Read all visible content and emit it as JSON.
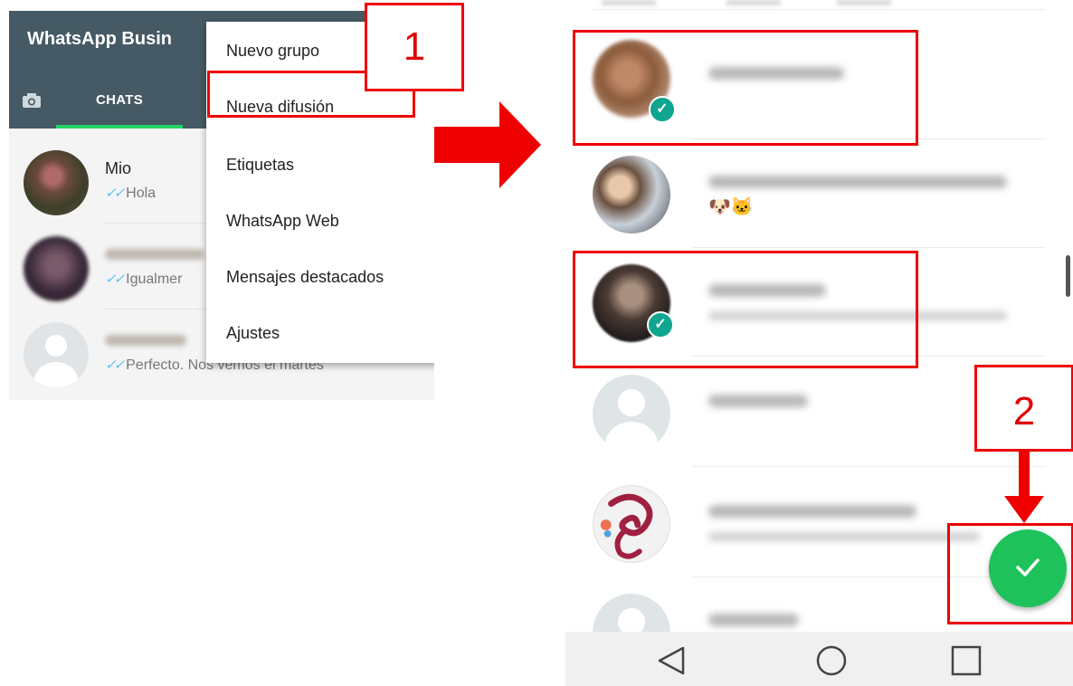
{
  "left_screen": {
    "app_title": "WhatsApp Busin",
    "tabs": [
      {
        "label": "CHATS",
        "selected": true
      }
    ],
    "chats": [
      {
        "name": "Mio",
        "last_message": "Hola",
        "name_blurred": false
      },
      {
        "name": "",
        "last_message": "Igualmer",
        "name_blurred": true
      },
      {
        "name": "",
        "last_message": "Perfecto. Nos vemos el martes",
        "name_blurred": true
      }
    ],
    "menu": {
      "items": [
        {
          "label": "Nuevo grupo"
        },
        {
          "label": "Nueva difusión",
          "highlighted": true
        },
        {
          "label": "Etiquetas"
        },
        {
          "label": "WhatsApp Web"
        },
        {
          "label": "Mensajes destacados"
        },
        {
          "label": "Ajustes"
        }
      ]
    }
  },
  "annotations": {
    "step_1": "1",
    "step_2": "2"
  },
  "right_screen": {
    "contacts": [
      {
        "selected": true,
        "avatar": "photo",
        "name_blurred": true
      },
      {
        "selected": false,
        "avatar": "photo",
        "name_blurred": true,
        "emoji": "🐶🐱"
      },
      {
        "selected": true,
        "avatar": "photo",
        "name_blurred": true
      },
      {
        "selected": false,
        "avatar": "placeholder",
        "name_blurred": true
      },
      {
        "selected": false,
        "avatar": "dragon",
        "name_blurred": true
      },
      {
        "selected": false,
        "avatar": "placeholder",
        "name_blurred": true
      }
    ],
    "fab_icon": "checkmark-icon",
    "nav_icons": [
      "back-triangle-icon",
      "home-circle-icon",
      "recents-square-icon"
    ]
  },
  "colors": {
    "toolbar": "#455a64",
    "tab_indicator": "#25d366",
    "read_ticks": "#4fc3f7",
    "annotation_red": "#ee0000",
    "check_badge": "#0fa58e",
    "fab": "#1ec25a"
  }
}
